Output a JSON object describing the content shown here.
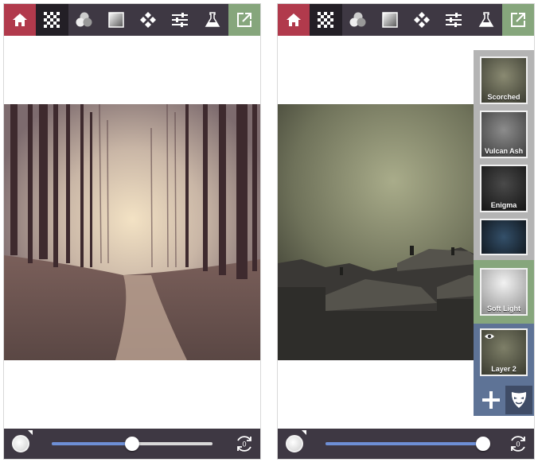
{
  "colors": {
    "toolbar_bg": "#3e3843",
    "home_bg": "#b13a4c",
    "active_bg": "#231f26",
    "export_bg": "#86a67c",
    "layer_gray": "#b4b4b4",
    "layer_green": "#86a67c",
    "layer_blue": "#5e7396"
  },
  "toolbar": {
    "icons": [
      "home-icon",
      "checkerboard-icon",
      "circles-icon",
      "gradient-square-icon",
      "diamonds-icon",
      "sliders-icon",
      "flask-icon",
      "export-icon"
    ]
  },
  "left_screen": {
    "slider_level": 0.5,
    "reset_count": "0"
  },
  "right_screen": {
    "slider_level": 1.0,
    "reset_count": "0",
    "textures": [
      {
        "label": "Scorched"
      },
      {
        "label": "Vulcan Ash"
      },
      {
        "label": "Enigma"
      },
      {
        "label": ""
      }
    ],
    "blend_mode": {
      "label": "Soft Light"
    },
    "layer": {
      "label": "Layer 2"
    }
  }
}
